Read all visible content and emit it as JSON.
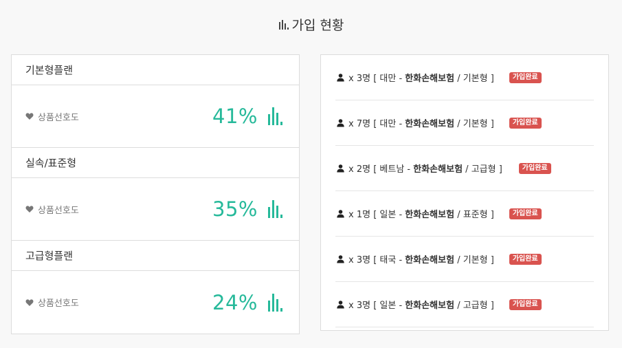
{
  "title": "가입 현황",
  "plans": [
    {
      "name": "기본형플랜",
      "pref_label": "상품선호도",
      "percent": "41%"
    },
    {
      "name": "실속/표준형",
      "pref_label": "상품선호도",
      "percent": "35%"
    },
    {
      "name": "고급형플랜",
      "pref_label": "상품선호도",
      "percent": "24%"
    }
  ],
  "signups": [
    {
      "count": "x 3명",
      "country": "대만",
      "insurer": "한화손해보험",
      "plan": "기본형",
      "status": "가입완료"
    },
    {
      "count": "x 7명",
      "country": "대만",
      "insurer": "한화손해보험",
      "plan": "기본형",
      "status": "가입완료"
    },
    {
      "count": "x 2명",
      "country": "베트남",
      "insurer": "한화손해보험",
      "plan": "고급형",
      "status": "가입완료"
    },
    {
      "count": "x 1명",
      "country": "일본",
      "insurer": "한화손해보험",
      "plan": "표준형",
      "status": "가입완료"
    },
    {
      "count": "x 3명",
      "country": "태국",
      "insurer": "한화손해보험",
      "plan": "기본형",
      "status": "가입완료"
    },
    {
      "count": "x 3명",
      "country": "일본",
      "insurer": "한화손해보험",
      "plan": "고급형",
      "status": "가입완료"
    }
  ],
  "colors": {
    "accent": "#26b99a",
    "badge": "#d9534f"
  },
  "icons": {
    "title": "bar-chart-icon",
    "preference": "heart-icon",
    "stat": "bar-chart-icon",
    "user": "user-icon"
  }
}
